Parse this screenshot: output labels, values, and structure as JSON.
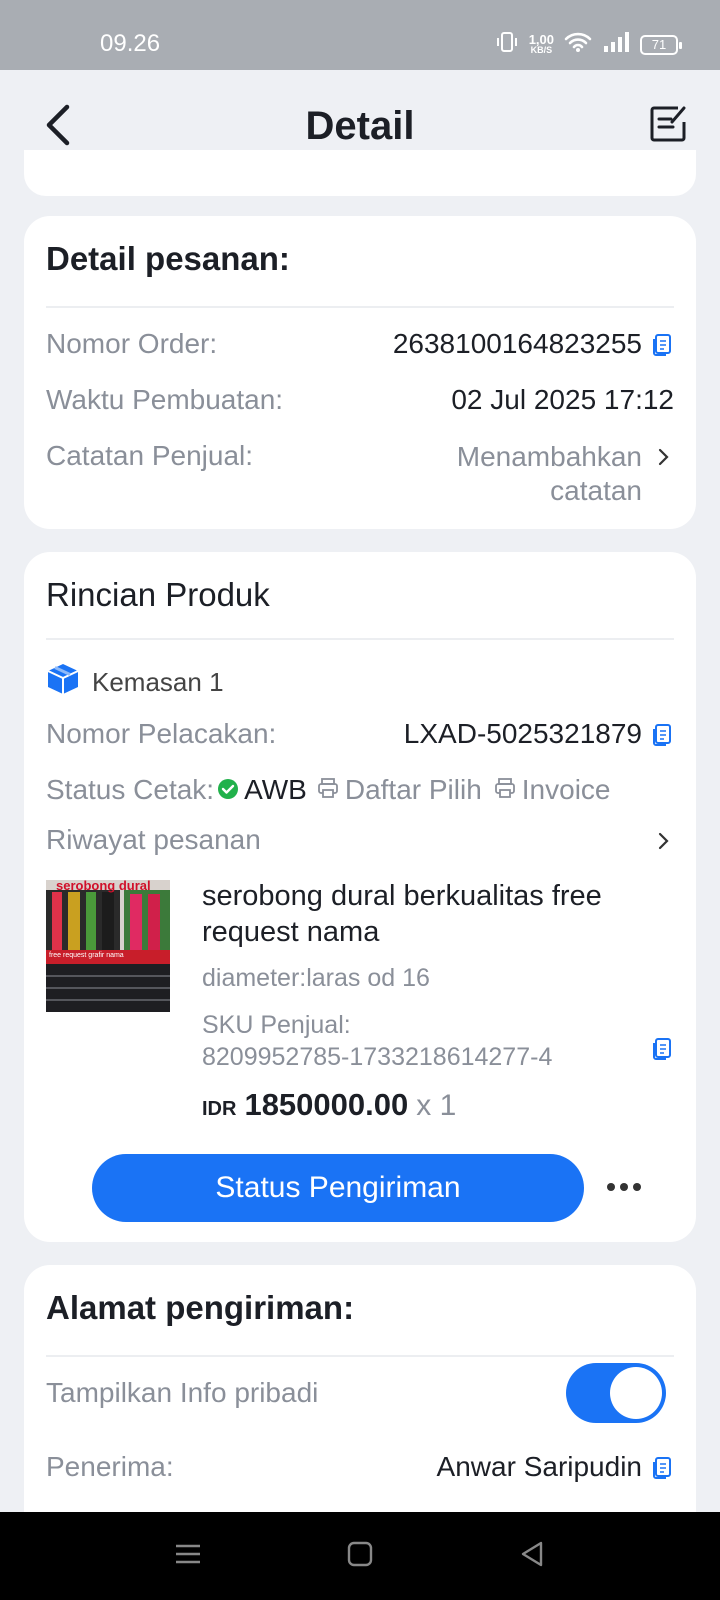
{
  "status_bar": {
    "time": "09.26",
    "net_speed_value": "1,00",
    "net_speed_unit": "KB/S",
    "battery": "71",
    "icons": [
      "vibrate-icon",
      "wifi-icon",
      "signal-icon",
      "battery-icon"
    ]
  },
  "header": {
    "title": "Detail",
    "back_icon": "chevron-left-icon",
    "edit_icon": "edit-note-icon"
  },
  "order_detail": {
    "title": "Detail pesanan:",
    "order_number_label": "Nomor Order:",
    "order_number": "2638100164823255",
    "created_label": "Waktu Pembuatan:",
    "created_time": "02 Jul 2025 17:12",
    "seller_note_label": "Catatan Penjual:",
    "seller_note_line1": "Menambahkan",
    "seller_note_line2": "catatan"
  },
  "product_detail": {
    "title": "Rincian Produk",
    "package_label": "Kemasan 1",
    "tracking_label": "Nomor Pelacakan:",
    "tracking_number": "LXAD-5025321879",
    "print_status_label": "Status Cetak:",
    "print_awb": "AWB",
    "print_pick_list": "Daftar Pilih",
    "print_invoice": "Invoice",
    "order_history_label": "Riwayat pesanan",
    "product": {
      "image_text_top": "serobong dural",
      "image_text_mid": "free request grafir nama",
      "name": "serobong dural berkualitas free request nama",
      "variant": "diameter:laras od 16",
      "sku_label": "SKU Penjual:",
      "sku": "8209952785-1733218614277-4",
      "currency": "IDR",
      "price": "1850000.00",
      "quantity": "x 1"
    },
    "primary_button": "Status Pengiriman"
  },
  "shipping_address": {
    "title": "Alamat pengiriman:",
    "show_personal_info_label": "Tampilkan Info pribadi",
    "show_personal_info_on": true,
    "recipient_label": "Penerima:",
    "recipient_name": "Anwar Saripudin"
  },
  "colors": {
    "accent": "#1a73f5",
    "success": "#21b14b",
    "background": "#eef0f4"
  }
}
